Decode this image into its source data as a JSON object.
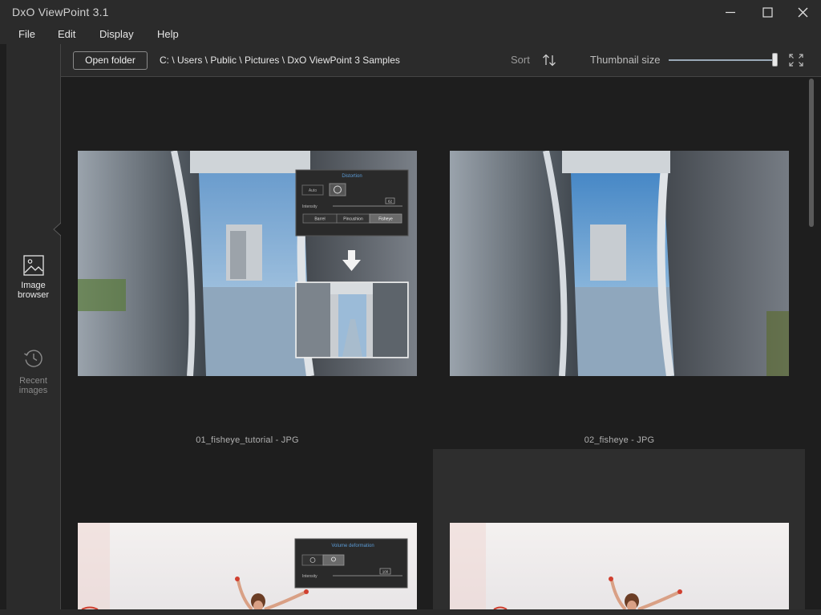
{
  "window": {
    "title": "DxO ViewPoint 3.1"
  },
  "menu": [
    {
      "label": "File"
    },
    {
      "label": "Edit"
    },
    {
      "label": "Display"
    },
    {
      "label": "Help"
    }
  ],
  "sidebar": {
    "items": [
      {
        "label_line1": "Image",
        "label_line2": "browser",
        "icon": "image-icon",
        "active": true
      },
      {
        "label_line1": "Recent",
        "label_line2": "images",
        "icon": "history-icon",
        "active": false
      }
    ]
  },
  "toolbar": {
    "open_folder_label": "Open folder",
    "path": "C: \\ Users \\ Public \\ Pictures \\ DxO ViewPoint 3 Samples",
    "sort_label": "Sort",
    "thumbnail_size_label": "Thumbnail size",
    "thumbnail_size_value": 0.98
  },
  "thumbnails": [
    {
      "caption": "01_fisheye_tutorial - JPG",
      "overlay": {
        "title": "Distortion",
        "auto_label": "Auto",
        "intensity_label": "Intensity",
        "intensity_value": "62",
        "modes": [
          "Barrel",
          "Pincushion",
          "Fisheye"
        ],
        "selected_mode": "Fisheye"
      }
    },
    {
      "caption": "02_fisheye - JPG"
    },
    {
      "caption": "",
      "overlay": {
        "title": "Volume deformation",
        "intensity_label": "Intensity",
        "intensity_value": "100"
      }
    },
    {
      "caption": ""
    }
  ],
  "colors": {
    "accent": "#3d6fb0",
    "background": "#1e1e1e",
    "panel": "#2b2b2b"
  }
}
